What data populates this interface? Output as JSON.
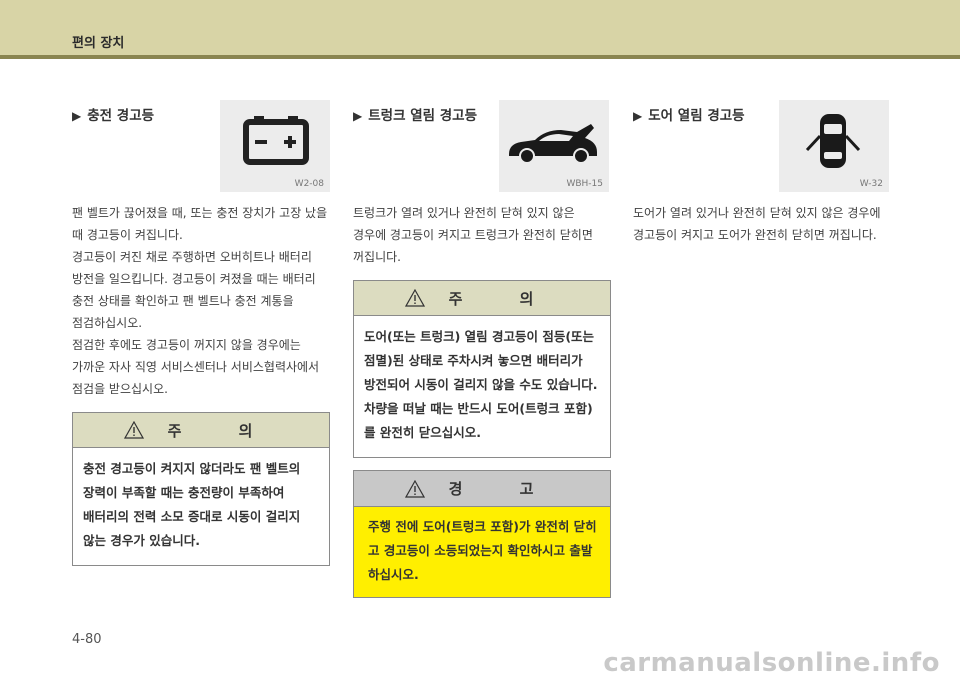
{
  "header": {
    "title": "편의 장치"
  },
  "sections": [
    {
      "title": "충전 경고등",
      "icon": "battery-icon",
      "icon_caption": "W2-08",
      "body": [
        "팬 벨트가 끊어졌을 때, 또는 충전 장치가 고장 났을 때 경고등이 켜집니다.",
        "경고등이 켜진 채로 주행하면 오버히트나 배터리 방전을 일으킵니다. 경고등이 켜졌을 때는 배터리 충전 상태를 확인하고 팬 벨트나 충전 계통을 점검하십시오.",
        "점검한 후에도 경고등이 꺼지지 않을 경우에는 가까운 자사 직영 서비스센터나 서비스협력사에서 점검을 받으십시오."
      ],
      "caution": {
        "title": "주 의",
        "text": "충전 경고등이 켜지지 않더라도 팬 벨트의 장력이 부족할 때는 충전량이 부족하여 배터리의 전력 소모 증대로 시동이 걸리지 않는 경우가 있습니다."
      }
    },
    {
      "title": "트렁크 열림 경고등",
      "icon": "trunk-open-car-icon",
      "icon_caption": "WBH-15",
      "body": [
        "트렁크가 열려 있거나 완전히 닫혀 있지 않은 경우에 경고등이 켜지고 트렁크가 완전히 닫히면 꺼집니다."
      ],
      "caution": {
        "title": "주 의",
        "text": "도어(또는 트렁크) 열림 경고등이 점등(또는 점멸)된 상태로 주차시켜 놓으면 배터리가 방전되어 시동이 걸리지 않을 수도 있습니다. 차량을 떠날 때는 반드시 도어(트렁크 포함)를 완전히 닫으십시오."
      },
      "warning": {
        "title": "경 고",
        "text": "주행 전에 도어(트렁크 포함)가 완전히 닫히고 경고등이 소등되었는지 확인하시고 출발하십시오."
      }
    },
    {
      "title": "도어 열림 경고등",
      "icon": "door-open-car-icon",
      "icon_caption": "W-32",
      "body": [
        "도어가 열려 있거나 완전히 닫혀 있지 않은 경우에 경고등이 켜지고 도어가 완전히 닫히면 꺼집니다."
      ]
    }
  ],
  "footer": {
    "page_number": "4-80",
    "watermark": "carmanualsonline.info"
  },
  "colors": {
    "header_band": "#d8d4a6",
    "header_rule": "#8a8550",
    "caution_head": "#dcdcc0",
    "warning_head": "#c8c8c8",
    "warning_body": "#ffef00"
  }
}
